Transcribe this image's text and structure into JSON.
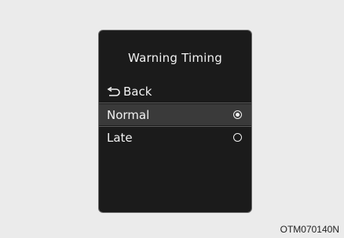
{
  "menu": {
    "title": "Warning Timing",
    "back_label": "Back",
    "options": [
      {
        "label": "Normal",
        "selected": true
      },
      {
        "label": "Late",
        "selected": false
      }
    ]
  },
  "caption": "OTM070140N",
  "colors": {
    "screen_bg": "#1b1b1b",
    "highlight_bg": "#3a3a3a",
    "text": "#f2f2f2",
    "page_bg": "#ebebeb"
  },
  "icons": {
    "back": "return-arrow-icon",
    "selected": "radio-selected-icon",
    "unselected": "radio-unselected-icon"
  }
}
